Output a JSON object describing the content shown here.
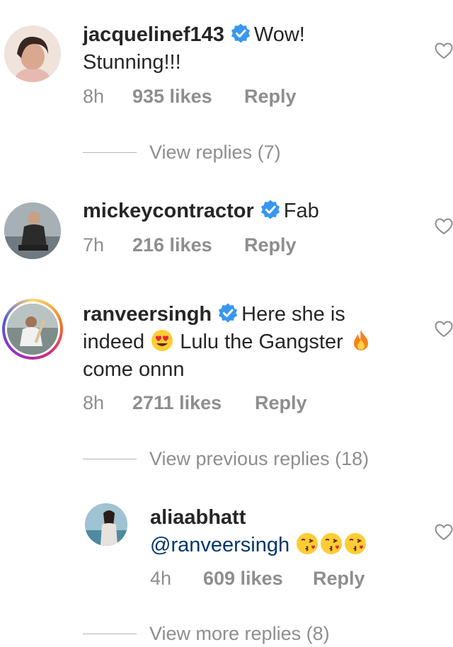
{
  "comments": [
    {
      "username": "jacquelinef143",
      "text_first": "Wow!",
      "text_rest": "Stunning!!!",
      "time": "8h",
      "likes": "935 likes",
      "reply": "Reply",
      "view_replies": "View replies (7)"
    },
    {
      "username": "mickeycontractor",
      "text_first": "Fab",
      "time": "7h",
      "likes": "216 likes",
      "reply": "Reply"
    },
    {
      "username": "ranveersingh",
      "text_first": "Here she is",
      "text_line2a": "indeed",
      "text_line2b": "Lulu the Gangster",
      "text_line3": "come onnn",
      "time": "8h",
      "likes": "2711 likes",
      "reply": "Reply",
      "view_replies": "View previous replies (18)"
    }
  ],
  "reply": {
    "username": "aliaabhatt",
    "mention": "@ranveersingh",
    "time": "4h",
    "likes": "609 likes",
    "reply": "Reply",
    "view_more": "View more replies (8)"
  },
  "icons": {
    "verified": "verified-badge-icon",
    "heart": "heart-outline-icon",
    "heart_eyes": "heart-eyes-emoji",
    "fire": "fire-emoji",
    "kiss": "kissing-face-emoji"
  },
  "colors": {
    "verified": "#3897f0",
    "meta": "#8e8e8e",
    "mention": "#00376b"
  }
}
